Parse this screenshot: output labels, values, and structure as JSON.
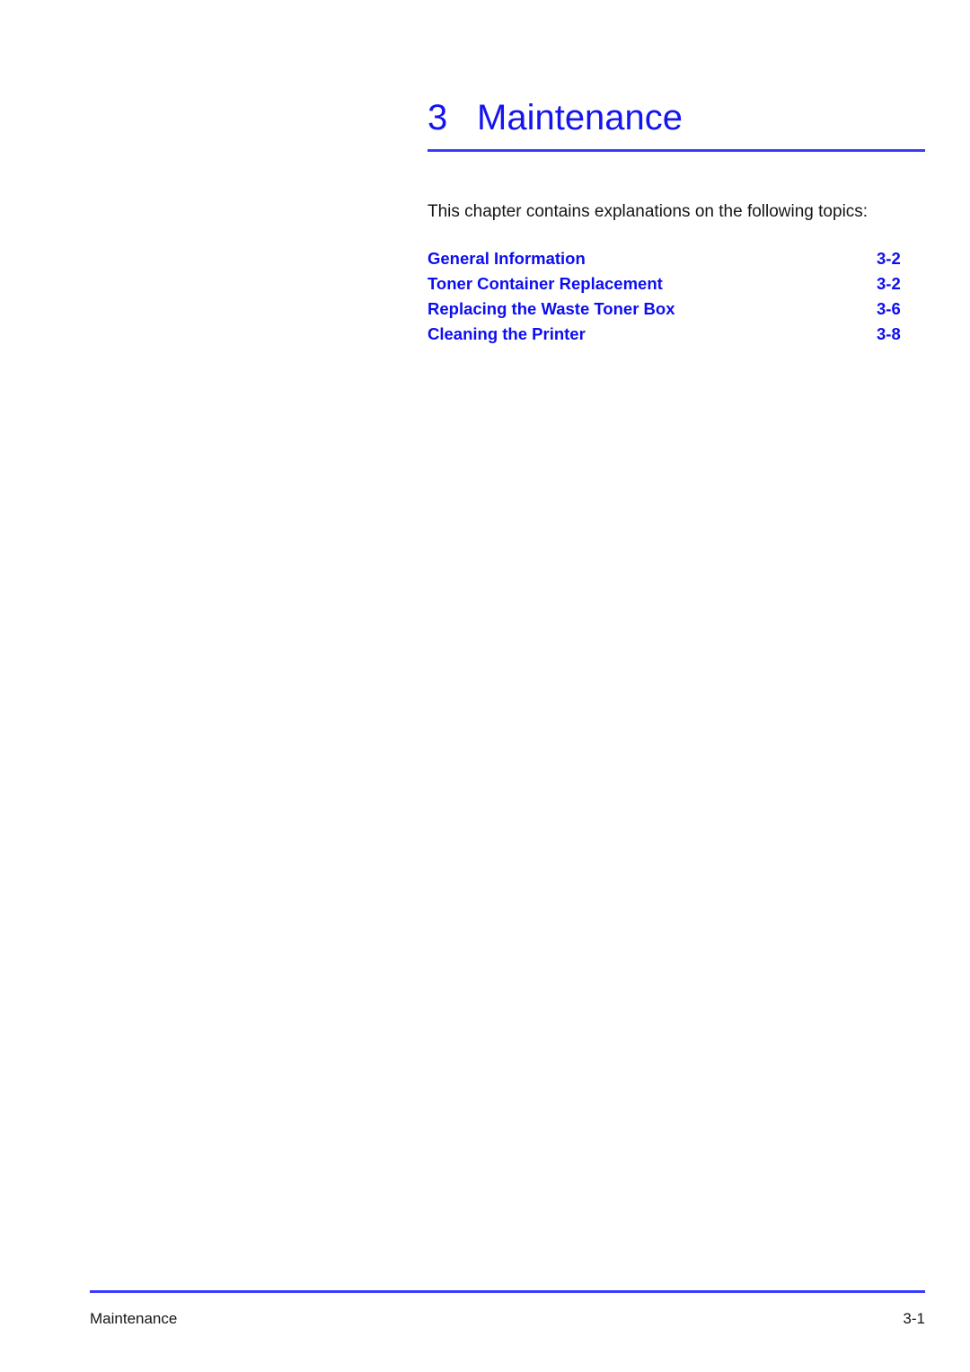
{
  "document": {
    "chapter_number": "3",
    "chapter_title": "Maintenance",
    "intro": "This chapter contains explanations on the following topics:"
  },
  "topics": [
    {
      "label": "General Information",
      "page": "3-2"
    },
    {
      "label": "Toner Container Replacement",
      "page": "3-2"
    },
    {
      "label": "Replacing the Waste Toner Box",
      "page": "3-6"
    },
    {
      "label": "Cleaning the Printer",
      "page": "3-8"
    }
  ],
  "footer": {
    "left": "Maintenance",
    "right": "3-1"
  },
  "colors": {
    "heading_blue": "#1414ee",
    "link_blue": "#0d0df0",
    "rule_blue": "#3a3aff",
    "body_text": "#151515",
    "page_background": "#ffffff"
  }
}
